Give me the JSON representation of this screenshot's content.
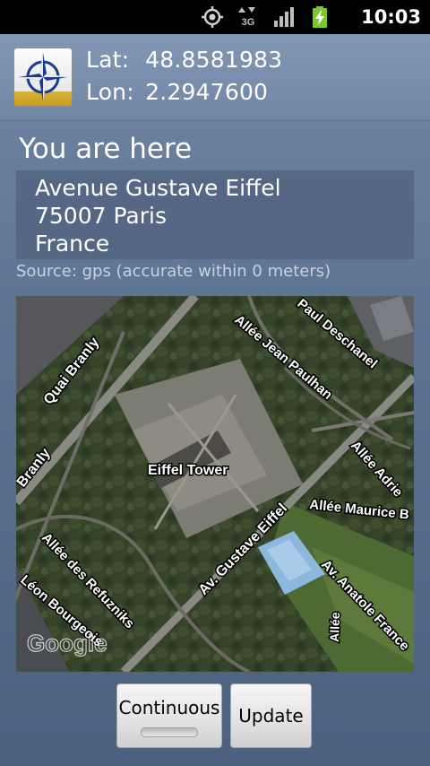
{
  "status_bar": {
    "time": "10:03",
    "icons": [
      "gps-icon",
      "network-3g-icon",
      "signal-icon",
      "battery-charging-icon"
    ],
    "network_label": "3G"
  },
  "header": {
    "lat_label": "Lat:",
    "lat_value": "48.8581983",
    "lon_label": "Lon:",
    "lon_value": "2.2947600",
    "app_icon": "compass-rose-icon"
  },
  "location": {
    "title": "You are here",
    "address_lines": [
      "Avenue Gustave Eiffel",
      "75007 Paris",
      "France"
    ],
    "source": "Source: gps (accurate within 0 meters)"
  },
  "map": {
    "labels": [
      "Quai Branly",
      "Branly",
      "Allée Jean Paulhan",
      "Paul Deschanel",
      "Eiffel Tower",
      "Av. Gustave Eiffel",
      "Allée Maurice B",
      "Allée Adrie",
      "Allée des Refuzniks",
      "Léon Bourgeois",
      "Av. Anatole France",
      "Allée",
      "Google"
    ]
  },
  "buttons": {
    "continuous": "Continuous",
    "update": "Update"
  }
}
